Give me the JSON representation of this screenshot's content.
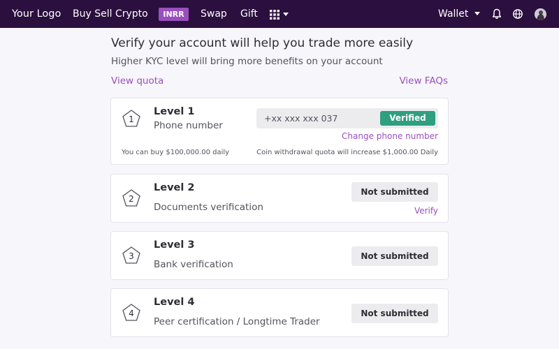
{
  "navbar": {
    "logo": "Your Logo",
    "buy_sell": "Buy Sell Crypto",
    "currency_badge": "INRR",
    "swap": "Swap",
    "gift": "Gift",
    "wallet": "Wallet",
    "icons": [
      "apps-grid-icon",
      "chevron-down-icon",
      "bell-icon",
      "globe-icon",
      "avatar"
    ]
  },
  "header": {
    "title": "Verify your account will help you trade more easily",
    "subtitle": "Higher KYC level will bring more benefits on your account",
    "view_quota": "View quota",
    "view_faqs": "View FAQs"
  },
  "levels": [
    {
      "number": "1",
      "title": "Level 1",
      "description": "Phone number",
      "phone_value": "+xx xxx xxx 037",
      "status": "Verified",
      "action": "Change phone number",
      "buy_quota": "You can buy $100,000.00 daily",
      "withdraw_quota": "Coin withdrawal quota will increase $1,000.00 Daily"
    },
    {
      "number": "2",
      "title": "Level 2",
      "description": "Documents verification",
      "status": "Not submitted",
      "action": "Verify"
    },
    {
      "number": "3",
      "title": "Level 3",
      "description": "Bank verification",
      "status": "Not submitted"
    },
    {
      "number": "4",
      "title": "Level 4",
      "description": "Peer certification / Longtime Trader",
      "status": "Not submitted"
    }
  ],
  "colors": {
    "navbar_bg": "#2b0f3e",
    "accent": "#9a4fbd",
    "verified": "#2e9f7f",
    "page_bg": "#f7f6fa"
  }
}
